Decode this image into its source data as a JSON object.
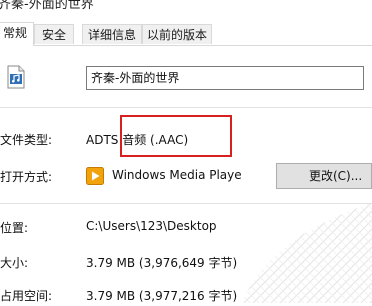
{
  "window": {
    "title_fragment": "齐秦-外面的世界"
  },
  "tabs": [
    {
      "label": "常规",
      "active": true
    },
    {
      "label": "安全",
      "active": false
    },
    {
      "label": "详细信息",
      "active": false
    },
    {
      "label": "以前的版本",
      "active": false
    }
  ],
  "general": {
    "file_name": "齐秦-外面的世界",
    "file_type_label": "文件类型:",
    "file_type_value": "ADTS 音频 (.AAC)",
    "opens_with_label": "打开方式:",
    "opens_with_value": "Windows Media Playe",
    "change_button": "更改(C)...",
    "location_label": "位置:",
    "location_value": "C:\\Users\\123\\Desktop",
    "size_label": "大小:",
    "size_value": "3.79 MB (3,976,649 字节)",
    "size_on_disk_label": "占用空间:",
    "size_on_disk_value": "3.79 MB (3,977,216 字节)"
  },
  "icons": {
    "file": "music-file-icon",
    "player": "windows-media-player-icon"
  },
  "colors": {
    "highlight_box": "#d92020",
    "tab_active_bg": "#ffffff",
    "tab_inactive_bg": "#f0f0f0"
  }
}
